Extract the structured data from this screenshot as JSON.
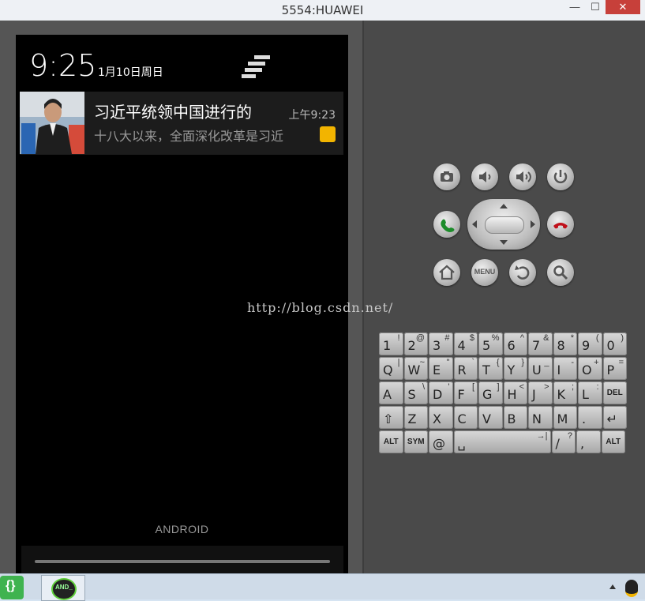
{
  "window": {
    "title": "5554:HUAWEI",
    "minimize": "—",
    "maximize": "☐",
    "close": "✕"
  },
  "statusbar": {
    "time": "9:25",
    "date": "1月10日周日"
  },
  "notification": {
    "title": "习近平统领中国进行的",
    "time": "上午9:23",
    "text": "十八大以来，全面深化改革是习近",
    "app_icon": "sina-icon"
  },
  "lockscreen": {
    "carrier": "ANDROID"
  },
  "watermark": "http://blog.csdn.net/",
  "keyboard": {
    "rows": [
      [
        {
          "m": "1",
          "a": "!"
        },
        {
          "m": "2",
          "a": "@"
        },
        {
          "m": "3",
          "a": "#"
        },
        {
          "m": "4",
          "a": "$"
        },
        {
          "m": "5",
          "a": "%"
        },
        {
          "m": "6",
          "a": "^"
        },
        {
          "m": "7",
          "a": "&"
        },
        {
          "m": "8",
          "a": "*"
        },
        {
          "m": "9",
          "a": "("
        },
        {
          "m": "0",
          "a": ")"
        }
      ],
      [
        {
          "m": "Q",
          "a": "|"
        },
        {
          "m": "W",
          "a": "~"
        },
        {
          "m": "E",
          "a": "\""
        },
        {
          "m": "R",
          "a": "`"
        },
        {
          "m": "T",
          "a": "{"
        },
        {
          "m": "Y",
          "a": "}"
        },
        {
          "m": "U",
          "a": "_"
        },
        {
          "m": "I",
          "a": "-"
        },
        {
          "m": "O",
          "a": "+"
        },
        {
          "m": "P",
          "a": "="
        }
      ],
      [
        {
          "m": "A",
          "a": ""
        },
        {
          "m": "S",
          "a": "\\"
        },
        {
          "m": "D",
          "a": "'"
        },
        {
          "m": "F",
          "a": "["
        },
        {
          "m": "G",
          "a": "]"
        },
        {
          "m": "H",
          "a": "<"
        },
        {
          "m": "J",
          "a": ">"
        },
        {
          "m": "K",
          "a": ";"
        },
        {
          "m": "L",
          "a": ":"
        },
        {
          "m": "DEL",
          "a": ""
        }
      ],
      [
        {
          "m": "⇧",
          "a": ""
        },
        {
          "m": "Z",
          "a": ""
        },
        {
          "m": "X",
          "a": ""
        },
        {
          "m": "C",
          "a": ""
        },
        {
          "m": "V",
          "a": ""
        },
        {
          "m": "B",
          "a": ""
        },
        {
          "m": "N",
          "a": ""
        },
        {
          "m": "M",
          "a": ""
        },
        {
          "m": ".",
          "a": ""
        },
        {
          "m": "↵",
          "a": ""
        }
      ],
      [
        {
          "m": "ALT",
          "a": ""
        },
        {
          "m": "SYM",
          "a": ""
        },
        {
          "m": "@",
          "a": ""
        },
        {
          "m": "␣",
          "a": "→|"
        },
        {
          "m": "/",
          "a": "?"
        },
        {
          "m": ",",
          "a": ""
        },
        {
          "m": "ALT",
          "a": ""
        }
      ]
    ]
  },
  "controls": {
    "menu_label": "MENU",
    "icons": [
      "camera-icon",
      "volume-down-icon",
      "volume-up-icon",
      "power-icon",
      "call-icon",
      "end-call-icon",
      "home-icon",
      "menu-icon",
      "back-icon",
      "search-icon"
    ]
  },
  "taskbar": {
    "app1_label": "{}",
    "app2_label": "AND_"
  }
}
